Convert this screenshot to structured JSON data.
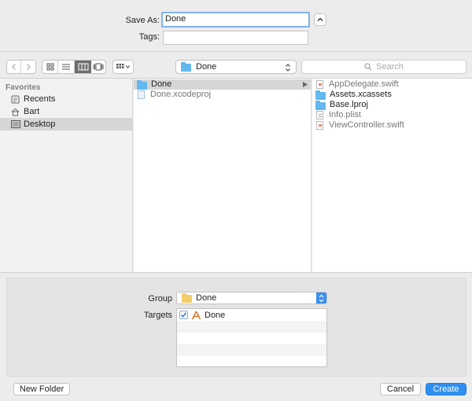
{
  "save_as": {
    "label": "Save As:",
    "value": "Done"
  },
  "tags": {
    "label": "Tags:",
    "value": ""
  },
  "toolbar": {
    "location": "Done",
    "search_placeholder": "Search"
  },
  "sidebar": {
    "section": "Favorites",
    "items": [
      {
        "label": "Recents",
        "icon": "recents-icon"
      },
      {
        "label": "Bart",
        "icon": "home-icon"
      },
      {
        "label": "Desktop",
        "icon": "desktop-icon",
        "selected": true
      }
    ]
  },
  "column1": [
    {
      "name": "Done",
      "kind": "folder",
      "selected": true
    },
    {
      "name": "Done.xcodeproj",
      "kind": "file"
    }
  ],
  "column2": [
    {
      "name": "AppDelegate.swift",
      "kind": "swift"
    },
    {
      "name": "Assets.xcassets",
      "kind": "folder"
    },
    {
      "name": "Base.lproj",
      "kind": "folder"
    },
    {
      "name": "Info.plist",
      "kind": "plist"
    },
    {
      "name": "ViewController.swift",
      "kind": "swift"
    }
  ],
  "options": {
    "group_label": "Group",
    "group_value": "Done",
    "targets_label": "Targets",
    "targets": [
      {
        "name": "Done",
        "checked": true
      }
    ]
  },
  "buttons": {
    "new_folder": "New Folder",
    "cancel": "Cancel",
    "create": "Create"
  },
  "colors": {
    "accent": "#2f8ff0",
    "folder": "#62b8ef",
    "selection": "#d6d6d6"
  }
}
